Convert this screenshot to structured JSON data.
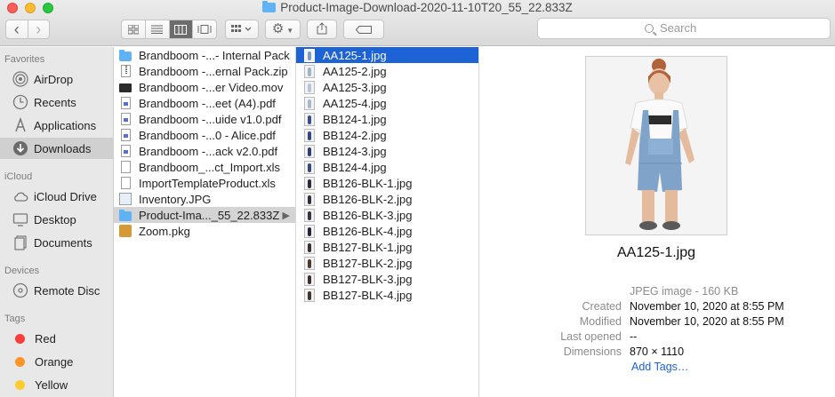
{
  "window": {
    "title": "Product-Image-Download-2020-11-10T20_55_22.833Z"
  },
  "toolbar": {
    "back": "‹",
    "forward": "›",
    "view_icons": [
      "icon-view",
      "list-view",
      "column-view",
      "gallery-view"
    ],
    "group_icon": "grid-icon",
    "action_icon": "gear-icon",
    "share_icon": "share-icon",
    "tag_icon": "tag-icon",
    "search_placeholder": "Search"
  },
  "sidebar": {
    "favorites_header": "Favorites",
    "favorites": [
      {
        "label": "AirDrop",
        "icon": "airdrop-icon"
      },
      {
        "label": "Recents",
        "icon": "clock-icon"
      },
      {
        "label": "Applications",
        "icon": "applications-icon"
      },
      {
        "label": "Downloads",
        "icon": "download-icon",
        "selected": true
      }
    ],
    "icloud_header": "iCloud",
    "icloud": [
      {
        "label": "iCloud Drive",
        "icon": "cloud-icon"
      },
      {
        "label": "Desktop",
        "icon": "desktop-icon"
      },
      {
        "label": "Documents",
        "icon": "document-icon"
      }
    ],
    "devices_header": "Devices",
    "devices": [
      {
        "label": "Remote Disc",
        "icon": "disc-icon"
      }
    ],
    "tags_header": "Tags",
    "tags": [
      {
        "label": "Red",
        "color": "#fc3d39"
      },
      {
        "label": "Orange",
        "color": "#fd9426"
      },
      {
        "label": "Yellow",
        "color": "#fecb2f"
      }
    ]
  },
  "column1": {
    "items": [
      {
        "label": "Brandboom -...- Internal Pack",
        "icon": "folder"
      },
      {
        "label": "Brandboom -...ernal Pack.zip",
        "icon": "zip"
      },
      {
        "label": "Brandboom -...er Video.mov",
        "icon": "mov"
      },
      {
        "label": "Brandboom -...eet (A4).pdf",
        "icon": "pdf"
      },
      {
        "label": "Brandboom -...uide v1.0.pdf",
        "icon": "pdf"
      },
      {
        "label": "Brandboom -...0 - Alice.pdf",
        "icon": "pdf"
      },
      {
        "label": "Brandboom -...ack v2.0.pdf",
        "icon": "pdf"
      },
      {
        "label": "Brandboom_...ct_Import.xls",
        "icon": "doc"
      },
      {
        "label": "ImportTemplateProduct.xls",
        "icon": "doc"
      },
      {
        "label": "Inventory.JPG",
        "icon": "img"
      },
      {
        "label": "Product-Ima..._55_22.833Z",
        "icon": "folder",
        "selected": true
      },
      {
        "label": "Zoom.pkg",
        "icon": "pkg"
      }
    ]
  },
  "column2": {
    "items": [
      {
        "label": "AA125-1.jpg",
        "fig": "#7a9ec4",
        "selected": true
      },
      {
        "label": "AA125-2.jpg",
        "fig": "#9fb4c9"
      },
      {
        "label": "AA125-3.jpg",
        "fig": "#b7c6d6"
      },
      {
        "label": "AA125-4.jpg",
        "fig": "#a8b9cb"
      },
      {
        "label": "BB124-1.jpg",
        "fig": "#3c4f86"
      },
      {
        "label": "BB124-2.jpg",
        "fig": "#34477d"
      },
      {
        "label": "BB124-3.jpg",
        "fig": "#2f3f70"
      },
      {
        "label": "BB124-4.jpg",
        "fig": "#39497a"
      },
      {
        "label": "BB126-BLK-1.jpg",
        "fig": "#2a2a3a"
      },
      {
        "label": "BB126-BLK-2.jpg",
        "fig": "#2f2f40"
      },
      {
        "label": "BB126-BLK-3.jpg",
        "fig": "#353545"
      },
      {
        "label": "BB126-BLK-4.jpg",
        "fig": "#262638"
      },
      {
        "label": "BB127-BLK-1.jpg",
        "fig": "#3a2f2a"
      },
      {
        "label": "BB127-BLK-2.jpg",
        "fig": "#4a3a30"
      },
      {
        "label": "BB127-BLK-3.jpg",
        "fig": "#3f3030"
      },
      {
        "label": "BB127-BLK-4.jpg",
        "fig": "#45352e"
      }
    ]
  },
  "preview": {
    "filename": "AA125-1.jpg",
    "kind": "JPEG image - 160 KB",
    "created_label": "Created",
    "created": "November 10, 2020 at 8:55 PM",
    "modified_label": "Modified",
    "modified": "November 10, 2020 at 8:55 PM",
    "last_opened_label": "Last opened",
    "last_opened": "--",
    "dimensions_label": "Dimensions",
    "dimensions": "870 × 1110",
    "add_tags": "Add Tags…"
  }
}
